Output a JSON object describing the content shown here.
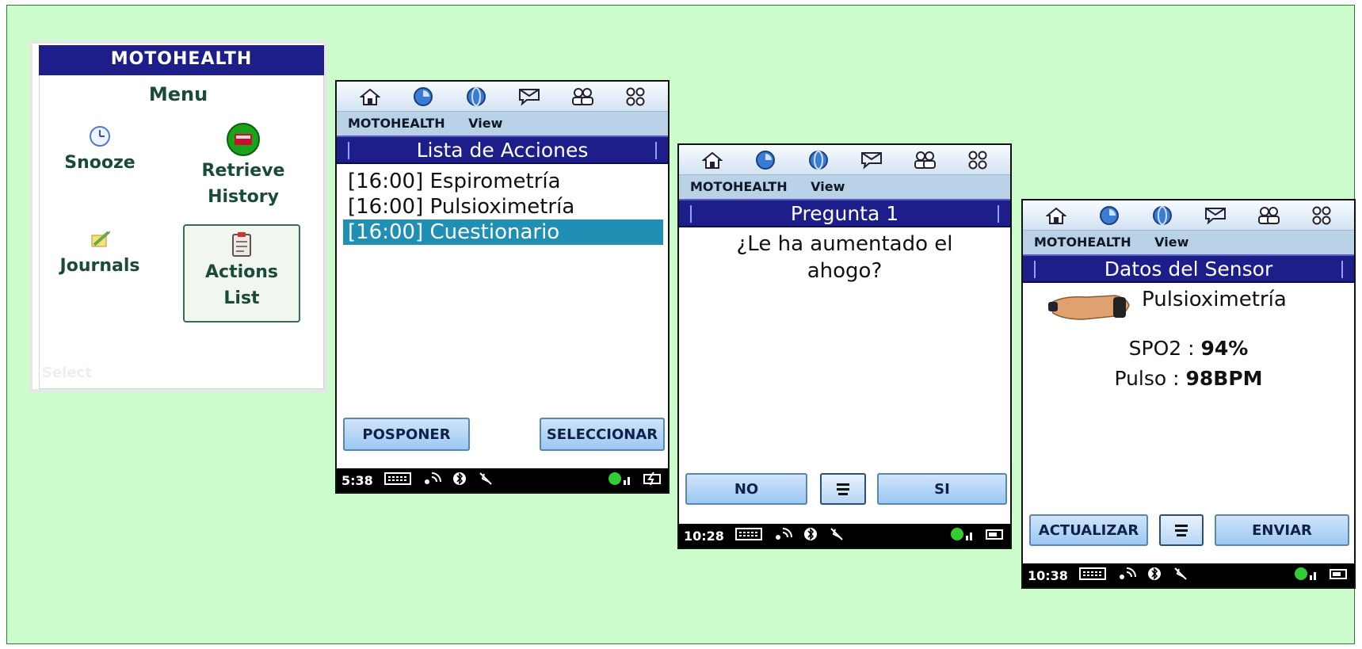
{
  "screen1": {
    "title": "MOTOHEALTH",
    "heading": "Menu",
    "items": [
      {
        "label_line1": "Snooze",
        "label_line2": ""
      },
      {
        "label_line1": "Retrieve",
        "label_line2": "History"
      },
      {
        "label_line1": "Journals",
        "label_line2": ""
      },
      {
        "label_line1": "Actions",
        "label_line2": "List"
      }
    ],
    "softkey": "Select"
  },
  "screen2": {
    "menubar": {
      "app": "MOTOHEALTH",
      "view": "View"
    },
    "title": "Lista de Acciones",
    "actions": [
      "[16:00] Espirometría",
      "[16:00] Pulsioximetría",
      "[16:00] Cuestionario"
    ],
    "selected_index": 2,
    "left_button": "POSPONER",
    "right_button": "SELECCIONAR",
    "status_time": "5:38"
  },
  "screen3": {
    "menubar": {
      "app": "MOTOHEALTH",
      "view": "View"
    },
    "title": "Pregunta 1",
    "question_line1": "¿Le ha aumentado el",
    "question_line2": "ahogo?",
    "left_button": "NO",
    "right_button": "SI",
    "status_time": "10:28"
  },
  "screen4": {
    "menubar": {
      "app": "MOTOHEALTH",
      "view": "View"
    },
    "title": "Datos del Sensor",
    "sensor": "Pulsioximetría",
    "spo2_label": "SPO2 :",
    "spo2_value": "94%",
    "pulse_label": "Pulso :",
    "pulse_value": "98BPM",
    "left_button": "ACTUALIZAR",
    "right_button": "ENVIAR",
    "status_time": "10:38"
  },
  "toolbar_icons": [
    "home-icon",
    "clock-icon",
    "globe-icon",
    "message-icon",
    "contacts-icon",
    "apps-icon"
  ],
  "colors": {
    "background": "#ccfccc",
    "title_bar": "#1d1e8a",
    "selection": "#1f8fb4",
    "menubar": "#b9d2e8"
  }
}
